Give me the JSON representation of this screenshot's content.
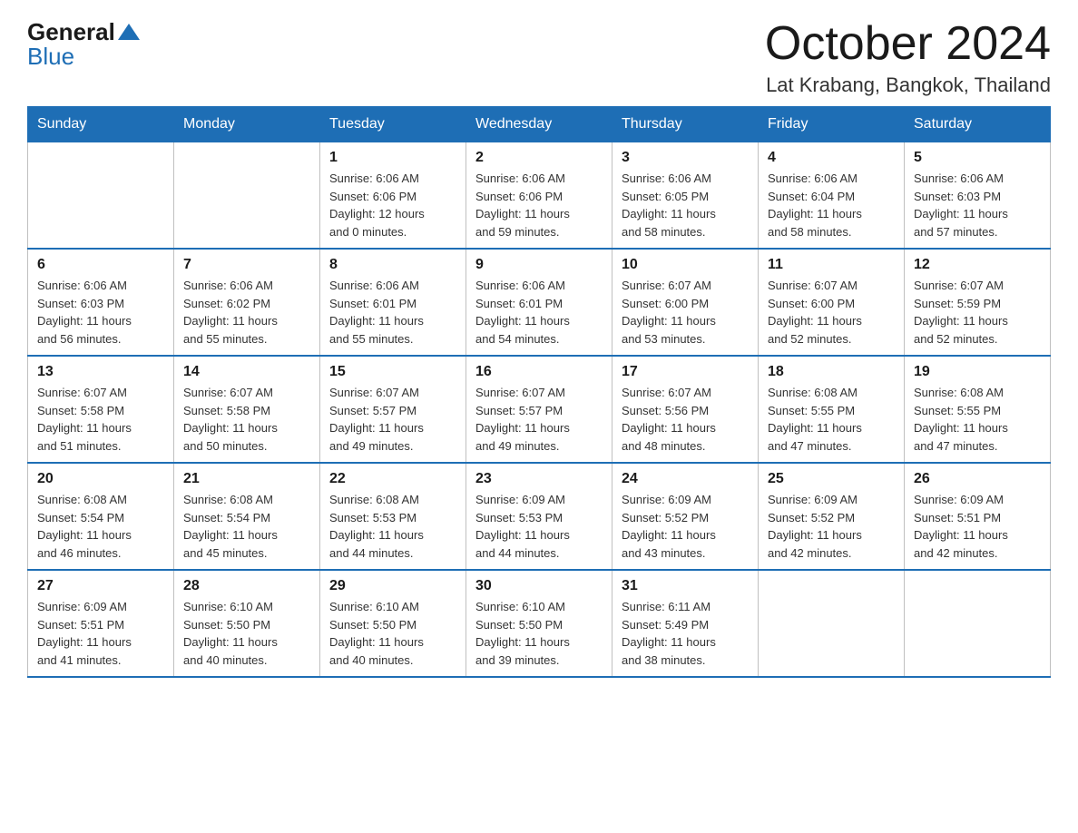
{
  "header": {
    "logo_general": "General",
    "logo_blue": "Blue",
    "month_title": "October 2024",
    "location": "Lat Krabang, Bangkok, Thailand"
  },
  "weekdays": [
    "Sunday",
    "Monday",
    "Tuesday",
    "Wednesday",
    "Thursday",
    "Friday",
    "Saturday"
  ],
  "weeks": [
    [
      {
        "day": "",
        "info": ""
      },
      {
        "day": "",
        "info": ""
      },
      {
        "day": "1",
        "info": "Sunrise: 6:06 AM\nSunset: 6:06 PM\nDaylight: 12 hours\nand 0 minutes."
      },
      {
        "day": "2",
        "info": "Sunrise: 6:06 AM\nSunset: 6:06 PM\nDaylight: 11 hours\nand 59 minutes."
      },
      {
        "day": "3",
        "info": "Sunrise: 6:06 AM\nSunset: 6:05 PM\nDaylight: 11 hours\nand 58 minutes."
      },
      {
        "day": "4",
        "info": "Sunrise: 6:06 AM\nSunset: 6:04 PM\nDaylight: 11 hours\nand 58 minutes."
      },
      {
        "day": "5",
        "info": "Sunrise: 6:06 AM\nSunset: 6:03 PM\nDaylight: 11 hours\nand 57 minutes."
      }
    ],
    [
      {
        "day": "6",
        "info": "Sunrise: 6:06 AM\nSunset: 6:03 PM\nDaylight: 11 hours\nand 56 minutes."
      },
      {
        "day": "7",
        "info": "Sunrise: 6:06 AM\nSunset: 6:02 PM\nDaylight: 11 hours\nand 55 minutes."
      },
      {
        "day": "8",
        "info": "Sunrise: 6:06 AM\nSunset: 6:01 PM\nDaylight: 11 hours\nand 55 minutes."
      },
      {
        "day": "9",
        "info": "Sunrise: 6:06 AM\nSunset: 6:01 PM\nDaylight: 11 hours\nand 54 minutes."
      },
      {
        "day": "10",
        "info": "Sunrise: 6:07 AM\nSunset: 6:00 PM\nDaylight: 11 hours\nand 53 minutes."
      },
      {
        "day": "11",
        "info": "Sunrise: 6:07 AM\nSunset: 6:00 PM\nDaylight: 11 hours\nand 52 minutes."
      },
      {
        "day": "12",
        "info": "Sunrise: 6:07 AM\nSunset: 5:59 PM\nDaylight: 11 hours\nand 52 minutes."
      }
    ],
    [
      {
        "day": "13",
        "info": "Sunrise: 6:07 AM\nSunset: 5:58 PM\nDaylight: 11 hours\nand 51 minutes."
      },
      {
        "day": "14",
        "info": "Sunrise: 6:07 AM\nSunset: 5:58 PM\nDaylight: 11 hours\nand 50 minutes."
      },
      {
        "day": "15",
        "info": "Sunrise: 6:07 AM\nSunset: 5:57 PM\nDaylight: 11 hours\nand 49 minutes."
      },
      {
        "day": "16",
        "info": "Sunrise: 6:07 AM\nSunset: 5:57 PM\nDaylight: 11 hours\nand 49 minutes."
      },
      {
        "day": "17",
        "info": "Sunrise: 6:07 AM\nSunset: 5:56 PM\nDaylight: 11 hours\nand 48 minutes."
      },
      {
        "day": "18",
        "info": "Sunrise: 6:08 AM\nSunset: 5:55 PM\nDaylight: 11 hours\nand 47 minutes."
      },
      {
        "day": "19",
        "info": "Sunrise: 6:08 AM\nSunset: 5:55 PM\nDaylight: 11 hours\nand 47 minutes."
      }
    ],
    [
      {
        "day": "20",
        "info": "Sunrise: 6:08 AM\nSunset: 5:54 PM\nDaylight: 11 hours\nand 46 minutes."
      },
      {
        "day": "21",
        "info": "Sunrise: 6:08 AM\nSunset: 5:54 PM\nDaylight: 11 hours\nand 45 minutes."
      },
      {
        "day": "22",
        "info": "Sunrise: 6:08 AM\nSunset: 5:53 PM\nDaylight: 11 hours\nand 44 minutes."
      },
      {
        "day": "23",
        "info": "Sunrise: 6:09 AM\nSunset: 5:53 PM\nDaylight: 11 hours\nand 44 minutes."
      },
      {
        "day": "24",
        "info": "Sunrise: 6:09 AM\nSunset: 5:52 PM\nDaylight: 11 hours\nand 43 minutes."
      },
      {
        "day": "25",
        "info": "Sunrise: 6:09 AM\nSunset: 5:52 PM\nDaylight: 11 hours\nand 42 minutes."
      },
      {
        "day": "26",
        "info": "Sunrise: 6:09 AM\nSunset: 5:51 PM\nDaylight: 11 hours\nand 42 minutes."
      }
    ],
    [
      {
        "day": "27",
        "info": "Sunrise: 6:09 AM\nSunset: 5:51 PM\nDaylight: 11 hours\nand 41 minutes."
      },
      {
        "day": "28",
        "info": "Sunrise: 6:10 AM\nSunset: 5:50 PM\nDaylight: 11 hours\nand 40 minutes."
      },
      {
        "day": "29",
        "info": "Sunrise: 6:10 AM\nSunset: 5:50 PM\nDaylight: 11 hours\nand 40 minutes."
      },
      {
        "day": "30",
        "info": "Sunrise: 6:10 AM\nSunset: 5:50 PM\nDaylight: 11 hours\nand 39 minutes."
      },
      {
        "day": "31",
        "info": "Sunrise: 6:11 AM\nSunset: 5:49 PM\nDaylight: 11 hours\nand 38 minutes."
      },
      {
        "day": "",
        "info": ""
      },
      {
        "day": "",
        "info": ""
      }
    ]
  ]
}
